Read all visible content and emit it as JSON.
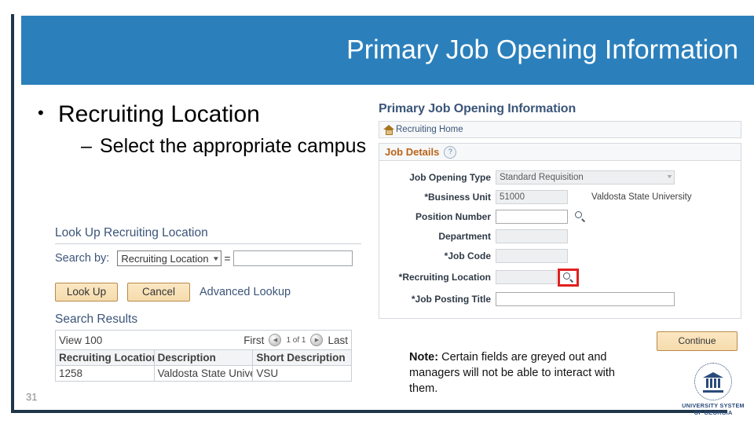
{
  "slide": {
    "title": "Primary Job Opening Information",
    "number": "31",
    "accent_color": "#2B80BC",
    "frame_color": "#1F3648"
  },
  "bullets": {
    "level1": "Recruiting Location",
    "level1_marker": "•",
    "level2": "Select the appropriate campus",
    "level2_marker": "–"
  },
  "lookup": {
    "heading": "Look Up Recruiting Location",
    "search_by_label": "Search by:",
    "search_by_value": "Recruiting Location",
    "equals": "=",
    "search_input_value": "",
    "look_up_button": "Look Up",
    "cancel_button": "Cancel",
    "advanced_lookup_link": "Advanced Lookup",
    "results_heading": "Search Results",
    "pager": {
      "view": "View 100",
      "first": "First",
      "prev_icon": "prev-arrow-icon",
      "count": "1 of 1",
      "next_icon": "next-arrow-icon",
      "last": "Last"
    },
    "columns": [
      "Recruiting Location",
      "Description",
      "Short Description"
    ],
    "rows": [
      [
        "1258",
        "Valdosta State University",
        "VSU"
      ]
    ]
  },
  "ps_panel": {
    "title": "Primary Job Opening Information",
    "recruiting_home": "Recruiting Home",
    "home_icon": "home-icon",
    "job_details": "Job Details",
    "help_icon": "help-question-icon",
    "fields": [
      {
        "label": "Job Opening Type",
        "value": "Standard Requisition",
        "type": "select-disabled"
      },
      {
        "label": "*Business Unit",
        "value": "51000",
        "type": "input-disabled",
        "description": "Valdosta State University"
      },
      {
        "label": "Position Number",
        "value": "",
        "type": "input-enabled",
        "lookup_icon": "magnifier-icon"
      },
      {
        "label": "Department",
        "value": "",
        "type": "input-disabled"
      },
      {
        "label": "*Job Code",
        "value": "",
        "type": "input-disabled"
      },
      {
        "label": "*Recruiting Location",
        "value": "",
        "type": "input-disabled",
        "lookup_icon": "magnifier-icon",
        "highlighted": true
      },
      {
        "label": "*Job Posting Title",
        "value": "",
        "type": "input-enabled"
      }
    ],
    "continue_button": "Continue",
    "highlight_color": "#E02020"
  },
  "note": {
    "prefix": "Note:",
    "text": " Certain fields are greyed out and managers will not be able to interact with them."
  },
  "logo": {
    "line1": "UNIVERSITY SYSTEM",
    "line2": "OF GEORGIA",
    "seal_icon": "classical-building-seal-icon",
    "color": "#2A4A7B"
  }
}
